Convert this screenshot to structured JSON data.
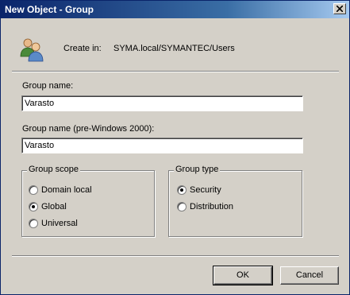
{
  "window": {
    "title": "New Object - Group"
  },
  "header": {
    "create_in_label": "Create in:",
    "create_in_path": "SYMA.local/SYMANTEC/Users",
    "icon": "group-users-icon"
  },
  "fields": {
    "group_name_label": "Group name:",
    "group_name_value": "Varasto",
    "group_name_pre2000_label": "Group name (pre-Windows 2000):",
    "group_name_pre2000_value": "Varasto"
  },
  "group_scope": {
    "title": "Group scope",
    "options": [
      {
        "label": "Domain local",
        "selected": false
      },
      {
        "label": "Global",
        "selected": true
      },
      {
        "label": "Universal",
        "selected": false
      }
    ]
  },
  "group_type": {
    "title": "Group type",
    "options": [
      {
        "label": "Security",
        "selected": true
      },
      {
        "label": "Distribution",
        "selected": false
      }
    ]
  },
  "buttons": {
    "ok_label": "OK",
    "cancel_label": "Cancel"
  },
  "colors": {
    "titlebar_start": "#0a246a",
    "titlebar_end": "#a6caf0",
    "dialog_face": "#d4d0c8"
  }
}
